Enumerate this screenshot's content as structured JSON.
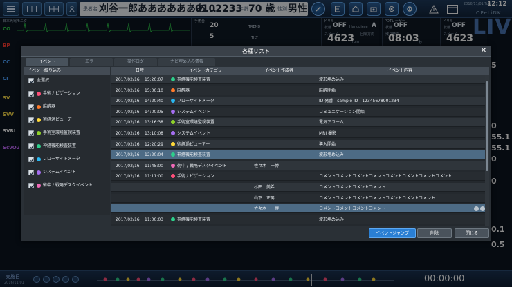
{
  "header": {
    "patient_name_label": "患者名",
    "patient_name": "刈谷一郎あああああああ...",
    "id_label": "ID",
    "patient_id": "0102233",
    "age_label": "年齢",
    "age": "70 歳",
    "sex_label": "性別",
    "sex": "男性",
    "date": "2016/11/01 Tue",
    "time": "12:12",
    "brand": "OPeLiNK"
  },
  "monitor": {
    "title": "日本光電モニタ",
    "labels": [
      "CO",
      "BP",
      "CC",
      "CI",
      "SV",
      "SVV",
      "SVRI",
      "ScvO2"
    ],
    "label_colors": [
      "#2ecc4a",
      "#ff3b30",
      "#4da3ff",
      "#4da3ff",
      "#ffe14a",
      "#ffe14a",
      "#ffffff",
      "#c56bff"
    ],
    "bp_value": "80"
  },
  "controls": {
    "v1": "20",
    "v2": "5",
    "trend": "TREND",
    "tilt": "TILT",
    "header": "手術台"
  },
  "devices": [
    {
      "title": "ドリル",
      "state_label": "状態",
      "state": "OFF",
      "hand_label": "Handpiece",
      "hand": "A",
      "speed_label": "スピード",
      "speed": "4623",
      "unit": "rpm",
      "dir_label": "回転方向"
    },
    {
      "title": "PDTレーザー",
      "state_label": "状態",
      "state": "OFF",
      "power_label": "残り時間",
      "power": "08:03",
      "unit": "秒"
    },
    {
      "title": "ドリル",
      "state_label": "状態",
      "state": "OFF",
      "hand_label": "Handpiece",
      "hand": "A",
      "speed_label": "スピード",
      "speed": "4623",
      "unit": "rpm",
      "dir_label": "回転方向"
    }
  ],
  "live_logo": "LIVE",
  "right_values": [
    "5",
    "0",
    "55.1",
    "55.1",
    "0",
    "0",
    "0.1",
    "0.5"
  ],
  "bottom": {
    "label": "実施日",
    "date": "2016/11/01",
    "timer": "00:00:00"
  },
  "dialog": {
    "title": "各種リスト",
    "tabs": [
      "イベント",
      "エラー",
      "操作ログ",
      "ナビ埋め込み情報"
    ],
    "filter_title": "イベント絞り込み",
    "filters": [
      {
        "label": "全選択",
        "color": ""
      },
      {
        "label": "手術ナビゲーション",
        "color": "#ff4f7a"
      },
      {
        "label": "麻酔器",
        "color": "#ff7a2a"
      },
      {
        "label": "術経過ビューアー",
        "color": "#ffd93a"
      },
      {
        "label": "手術室環境監視装置",
        "color": "#8fd12a"
      },
      {
        "label": "神経機能検査装置",
        "color": "#2ecf8b"
      },
      {
        "label": "フローサイトメータ",
        "color": "#2ab7f0"
      },
      {
        "label": "システムイベント",
        "color": "#a56ef0"
      },
      {
        "label": "術中 / 戦略デスクイベント",
        "color": "#f06ab8"
      }
    ],
    "columns": [
      "日時",
      "イベントカテゴリ",
      "イベント作成者",
      "イベント内容"
    ],
    "rows": [
      {
        "date": "2017/02/16",
        "time": "15:20:07",
        "category": "神経機能検査装置",
        "color": "#2ecf8b",
        "author": "",
        "content": "波形埋め込み"
      },
      {
        "date": "2017/02/16",
        "time": "15:00:10",
        "category": "麻酔器",
        "color": "#ff7a2a",
        "author": "",
        "content": "麻酔開始"
      },
      {
        "date": "2017/02/16",
        "time": "14:20:40",
        "category": "フローサイトメータ",
        "color": "#2ab7f0",
        "author": "",
        "content": "ID 発番　sample ID : 12345678901234"
      },
      {
        "date": "2017/02/16",
        "time": "14:00:05",
        "category": "システムイベント",
        "color": "#a56ef0",
        "author": "",
        "content": "コミュニケーション開始"
      },
      {
        "date": "2017/02/16",
        "time": "13:16:38",
        "category": "手術室環境監視装置",
        "color": "#8fd12a",
        "author": "",
        "content": "電気アラーム"
      },
      {
        "date": "2017/02/16",
        "time": "13:10:08",
        "category": "システムイベント",
        "color": "#a56ef0",
        "author": "",
        "content": "MRI 撮影"
      },
      {
        "date": "2017/02/16",
        "time": "12:20:29",
        "category": "術経過ビューアー",
        "color": "#ffd93a",
        "author": "",
        "content": "導入開始"
      },
      {
        "date": "2017/02/16",
        "time": "12:20:04",
        "category": "神経機能検査装置",
        "color": "#2ecf8b",
        "author": "",
        "content": "波形埋め込み",
        "selected": true
      },
      {
        "date": "2017/02/16",
        "time": "11:45:00",
        "category": "術中 / 戦略デスクイベント",
        "color": "#f06ab8",
        "author": "佐々木　一博",
        "content": ""
      },
      {
        "date": "2017/02/16",
        "time": "11:11:00",
        "category": "手術ナビゲーション",
        "color": "#ff4f7a",
        "author": "",
        "content": "コメントコメントコメントコメントコメントコメントコメントコメント"
      },
      {
        "date": "",
        "time": "",
        "category": "",
        "color": "",
        "author": "杉田　美希",
        "content": "コメントコメントコメントコメント"
      },
      {
        "date": "",
        "time": "",
        "category": "",
        "color": "",
        "author": "山下　正男",
        "content": "コメントコメントコメントコメントコメントコメントコメント"
      },
      {
        "date": "",
        "time": "",
        "category": "",
        "color": "",
        "author": "佐々木　一博",
        "content": "コメントコメントコメントコメント",
        "selected": true,
        "icons": true
      },
      {
        "date": "2017/02/16",
        "time": "11:00:03",
        "category": "神経機能検査装置",
        "color": "#2ecf8b",
        "author": "",
        "content": "波形埋め込み"
      }
    ],
    "buttons": {
      "jump": "イベントジャンプ",
      "delete": "削除",
      "close": "閉じる"
    }
  }
}
